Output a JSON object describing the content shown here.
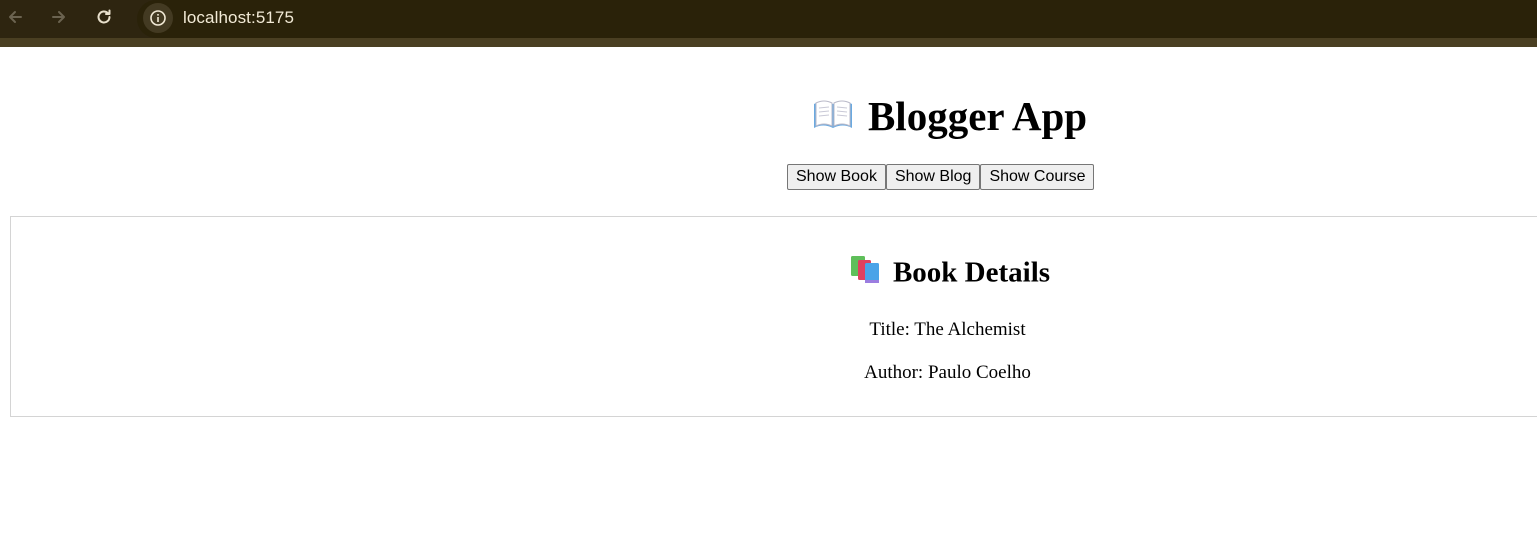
{
  "browser": {
    "url": "localhost:5175",
    "icons": {
      "back": "back-arrow-icon",
      "forward": "forward-arrow-icon",
      "reload": "reload-icon",
      "site_info": "info-icon"
    },
    "colors": {
      "bar": "#2e2510",
      "url_text": "#f2ead6"
    }
  },
  "app": {
    "title": "Blogger App",
    "title_icon": "open-book-icon",
    "buttons": [
      "Show Book",
      "Show Blog",
      "Show Course"
    ]
  },
  "book_card": {
    "heading": "Book Details",
    "heading_icon": "books-icon",
    "title_line": "Title: The Alchemist",
    "author_line": "Author: Paulo Coelho"
  }
}
